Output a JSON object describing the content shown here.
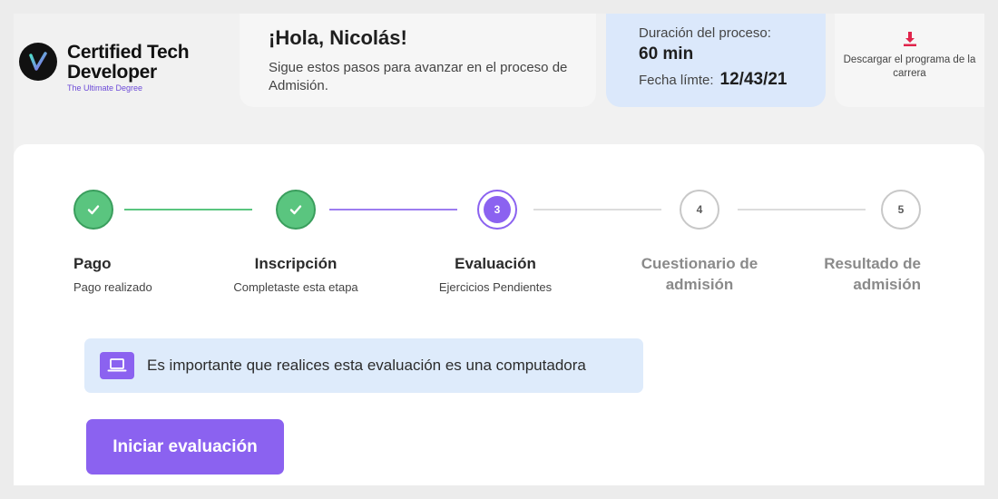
{
  "brand": {
    "line1": "Certified Tech",
    "line2": "Developer",
    "tagline": "The Ultimate Degree"
  },
  "greeting": {
    "title": "¡Hola, Nicolás!",
    "subtitle": "Sigue estos pasos para avanzar en el proceso de Admisión."
  },
  "process": {
    "duration_label": "Duración del proceso:",
    "duration_value": "60 min",
    "deadline_label": "Fecha límte:",
    "deadline_value": "12/43/21"
  },
  "download": {
    "icon": "download-icon",
    "label": "Descargar el programa de la carrera"
  },
  "steps": [
    {
      "number": "1",
      "status": "done",
      "label": "Pago",
      "sublabel": "Pago realizado"
    },
    {
      "number": "2",
      "status": "done",
      "label": "Inscripción",
      "sublabel": "Completaste esta etapa"
    },
    {
      "number": "3",
      "status": "current",
      "label": "Evaluación",
      "sublabel": "Ejercicios Pendientes"
    },
    {
      "number": "4",
      "status": "pending",
      "label": "Cuestionario de admisión",
      "sublabel": ""
    },
    {
      "number": "5",
      "status": "pending",
      "label": "Resultado de admisión",
      "sublabel": ""
    }
  ],
  "notice": {
    "icon": "laptop-icon",
    "text": "Es importante que realices esta evaluación es una computadora"
  },
  "start_button": {
    "label": "Iniciar evaluación"
  },
  "colors": {
    "accent": "#8b62f0",
    "done": "#5ac57f",
    "info_bg": "#dbe8fb",
    "download_red": "#e0244b"
  }
}
